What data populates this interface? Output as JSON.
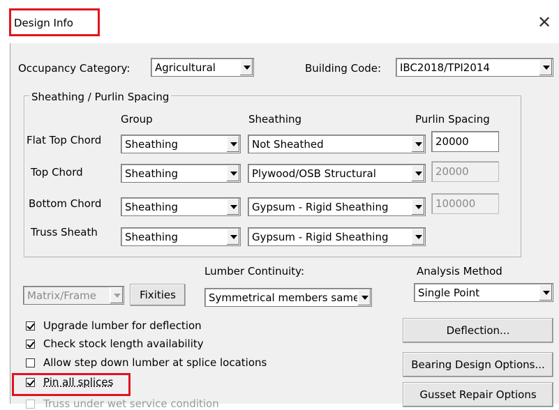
{
  "window": {
    "title": "Design Info",
    "close_label": "✕"
  },
  "top": {
    "occupancy_label": "Occupancy Category:",
    "occupancy_value": "Agricultural",
    "building_code_label": "Building Code:",
    "building_code_value": "IBC2018/TPI2014"
  },
  "sheathing": {
    "group_title": "Sheathing / Purlin Spacing",
    "col_group": "Group",
    "col_sheathing": "Sheathing",
    "col_purlin": "Purlin Spacing",
    "rows": [
      {
        "label": "Flat Top Chord",
        "group": "Sheathing",
        "sheathing": "Not Sheathed",
        "purlin": "20000",
        "purlin_enabled": true
      },
      {
        "label": "Top Chord",
        "group": "Sheathing",
        "sheathing": "Plywood/OSB Structural",
        "purlin": "20000",
        "purlin_enabled": false
      },
      {
        "label": "Bottom Chord",
        "group": "Sheathing",
        "sheathing": "Gypsum - Rigid Sheathing",
        "purlin": "100000",
        "purlin_enabled": false
      },
      {
        "label": "Truss Sheath",
        "group": "Sheathing",
        "sheathing": "Gypsum - Rigid Sheathing"
      }
    ]
  },
  "analysis": {
    "matrix_value": "Matrix/Frame",
    "fixities_label": "Fixities",
    "lumber_continuity_label": "Lumber Continuity:",
    "lumber_continuity_value": "Symmetrical members same",
    "analysis_method_label": "Analysis Method",
    "analysis_method_value": "Single Point"
  },
  "options": [
    {
      "label": "Upgrade lumber for deflection",
      "checked": true
    },
    {
      "label": "Check stock length availability",
      "checked": true
    },
    {
      "label": "Allow step down lumber at splice locations",
      "checked": false
    },
    {
      "label": "Pin all splices",
      "checked": true
    },
    {
      "label": "Truss under wet service condition",
      "checked": false
    }
  ],
  "buttons": {
    "deflection": "Deflection...",
    "bearing": "Bearing Design Options...",
    "gusset": "Gusset Repair Options"
  },
  "colors": {
    "highlight": "#e0141e",
    "dialog_bg": "#f0f0f0"
  }
}
